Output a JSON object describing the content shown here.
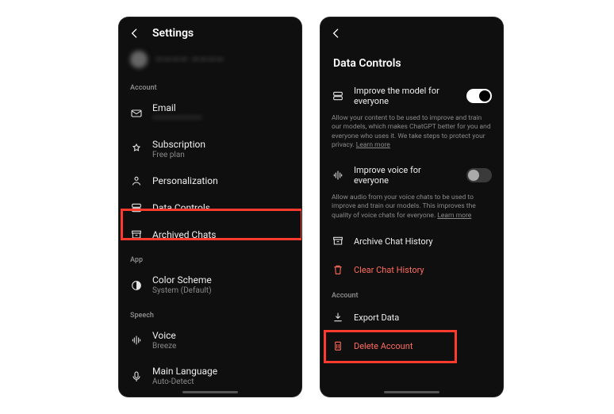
{
  "left": {
    "header_title": "Settings",
    "user_display": "———— ————",
    "sections": {
      "account": "Account",
      "app": "App",
      "speech": "Speech"
    },
    "items": {
      "email": {
        "label": "Email",
        "sub": "————————"
      },
      "subscription": {
        "label": "Subscription",
        "sub": "Free plan"
      },
      "personalization": {
        "label": "Personalization"
      },
      "data_controls": {
        "label": "Data Controls"
      },
      "archived_chats": {
        "label": "Archived Chats"
      },
      "color_scheme": {
        "label": "Color Scheme",
        "sub": "System (Default)"
      },
      "voice": {
        "label": "Voice",
        "sub": "Breeze"
      },
      "main_language": {
        "label": "Main Language",
        "sub": "Auto-Detect"
      }
    }
  },
  "right": {
    "header_title": "Data Controls",
    "improve_model": {
      "label": "Improve the model for everyone",
      "on": true,
      "help": "Allow your content to be used to improve and train our models, which makes ChatGPT better for you and everyone who uses it. We take steps to protect your privacy.",
      "learn_more": "Learn more"
    },
    "improve_voice": {
      "label": "Improve voice for everyone",
      "on": false,
      "help": "Allow audio from your voice chats to be used to improve and train our models. This improves the quality of voice chats for everyone.",
      "learn_more": "Learn more"
    },
    "archive_history": {
      "label": "Archive Chat History"
    },
    "clear_history": {
      "label": "Clear Chat History"
    },
    "account_section": "Account",
    "export_data": {
      "label": "Export Data"
    },
    "delete_account": {
      "label": "Delete Account"
    }
  }
}
